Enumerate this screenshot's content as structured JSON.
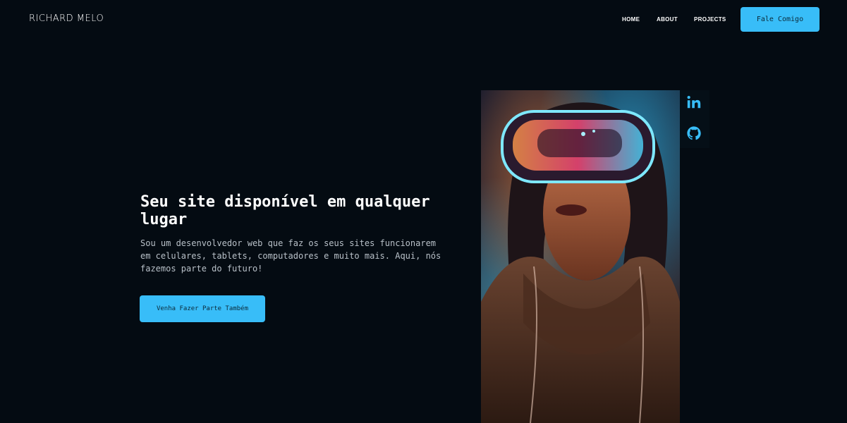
{
  "header": {
    "brand": "RICHARD MELO",
    "nav": {
      "home": "HOME",
      "about": "ABOUT",
      "projects": "PROJECTS"
    },
    "contact_button": "Fale Comigo"
  },
  "hero": {
    "headline": "Seu site disponível em qualquer lugar",
    "subtitle": "Sou um desenvolvedor web que faz os seus sites funcionarem em celulares, tablets, computadores e muito mais. Aqui, nós fazemos parte do futuro!",
    "cta_button": "Venha Fazer Parte Também"
  },
  "social": {
    "icons": [
      "linkedin-icon",
      "github-icon"
    ]
  },
  "colors": {
    "background": "#040b12",
    "accent": "#38bdf8",
    "text": "#ffffff",
    "muted_text": "#b8c0c8"
  }
}
